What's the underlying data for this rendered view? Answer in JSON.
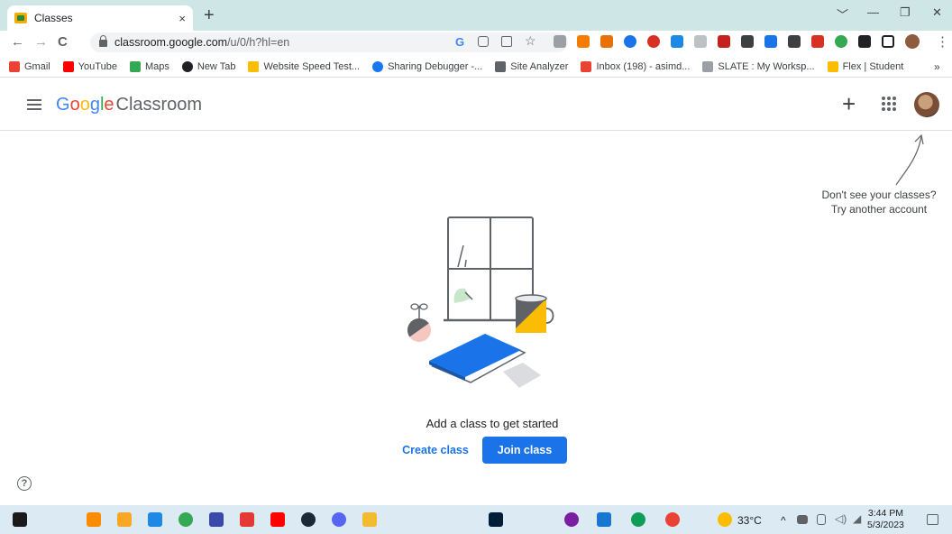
{
  "browser": {
    "tab_title": "Classes",
    "tab_close": "×",
    "new_tab": "+",
    "window_controls": [
      "﹀",
      "—",
      "❐",
      "✕"
    ],
    "url_host": "classroom.google.com",
    "url_path": "/u/0/h?hl=en",
    "nav_back": "←",
    "nav_forward": "→",
    "nav_reload": "C",
    "menu": "⋮",
    "bookmarks": [
      {
        "label": "Gmail",
        "color": "#ea4335"
      },
      {
        "label": "YouTube",
        "color": "#ff0000"
      },
      {
        "label": "Maps",
        "color": "#34a853"
      },
      {
        "label": "New Tab",
        "color": "#202124"
      },
      {
        "label": "Website Speed Test...",
        "color": "#fbbc04"
      },
      {
        "label": "Sharing Debugger -...",
        "color": "#1877f2"
      },
      {
        "label": "Site Analyzer",
        "color": "#5f6368"
      },
      {
        "label": "Inbox (198) - asimd...",
        "color": "#ea4335"
      },
      {
        "label": "SLATE : My Worksp...",
        "color": "#5f6368"
      },
      {
        "label": "Flex | Student",
        "color": "#fbbc04"
      }
    ],
    "bookmarks_more": "»"
  },
  "app": {
    "logo_google": [
      "G",
      "o",
      "o",
      "g",
      "l",
      "e"
    ],
    "logo_product": "Classroom",
    "add_icon": "+",
    "hint_line1": "Don't see your classes?",
    "hint_line2": "Try another account",
    "empty_message": "Add a class to get started",
    "create_class": "Create class",
    "join_class": "Join class",
    "help": "?"
  },
  "taskbar": {
    "weather": "33°C",
    "time": "3:44 PM",
    "date": "5/3/2023",
    "tray_arrow": "^"
  },
  "colors": {
    "accent": "#1a73e8",
    "chrome_frame": "#cfe6e6",
    "taskbar": "#dbeaf3"
  }
}
